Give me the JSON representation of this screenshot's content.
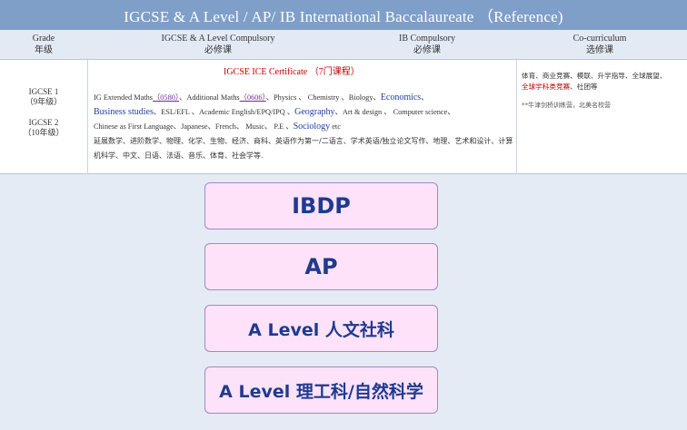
{
  "title": "IGCSE & A Level / AP/ IB International Baccalaureate （Reference)",
  "header": {
    "grade_en": "Grade",
    "grade_cn": "年级",
    "igcse_en": "IGCSE & A Level Compulsory",
    "igcse_cn": "必修课",
    "ib_en": "IB Compulsory",
    "ib_cn": "必修课",
    "co_en": "Co-curriculum",
    "co_cn": "选修课"
  },
  "content": {
    "cert_title": "IGCSE ICE Certificate （7门课程）",
    "grade1": "IGCSE 1",
    "grade1_cn": "（9年级）",
    "grade2": "IGCSE 2",
    "grade2_cn": "（10年级）",
    "subjects": {
      "s1": "IG Extended Maths",
      "s1_code": "（0580）",
      "s2": "、Additional Maths",
      "s2_code": "（0606）",
      "s3": "、Physics 、 Chemistry 、Biology、",
      "s3_blue": "Economics",
      "s3_end": "、",
      "s4_blue": "Business studies",
      "s4": "、ESL/EFL 、Academic English/EPQ/IPQ 、",
      "s4_blue2": "Geography",
      "s4_end": "、Art & design 、 Computer science、",
      "s5": "Chinese as First Language、Japanese、French、 Music、 P.E 、",
      "s5_blue": "Sociology",
      "s5_end": "etc",
      "s6": "延展数学、进阶数学、物理、化学、生物、经济、商科、英语作为第一/二语言、学术英语/独立论文写作、地理、艺术和设计、计算机科学、中文、日语、法语、音乐、体育、社会学等."
    },
    "co": {
      "line1": "体育、商业竞赛、模联、升学指导、全球展望、",
      "line2_red": "全球学科类竞赛",
      "line2": "、社团等",
      "note": "**牛津剑桥训练营，北美名校营"
    }
  },
  "programs": {
    "p1": "IBDP",
    "p2": "AP",
    "p3": "A Level 人文社科",
    "p4": "A Level 理工科/自然科学"
  }
}
